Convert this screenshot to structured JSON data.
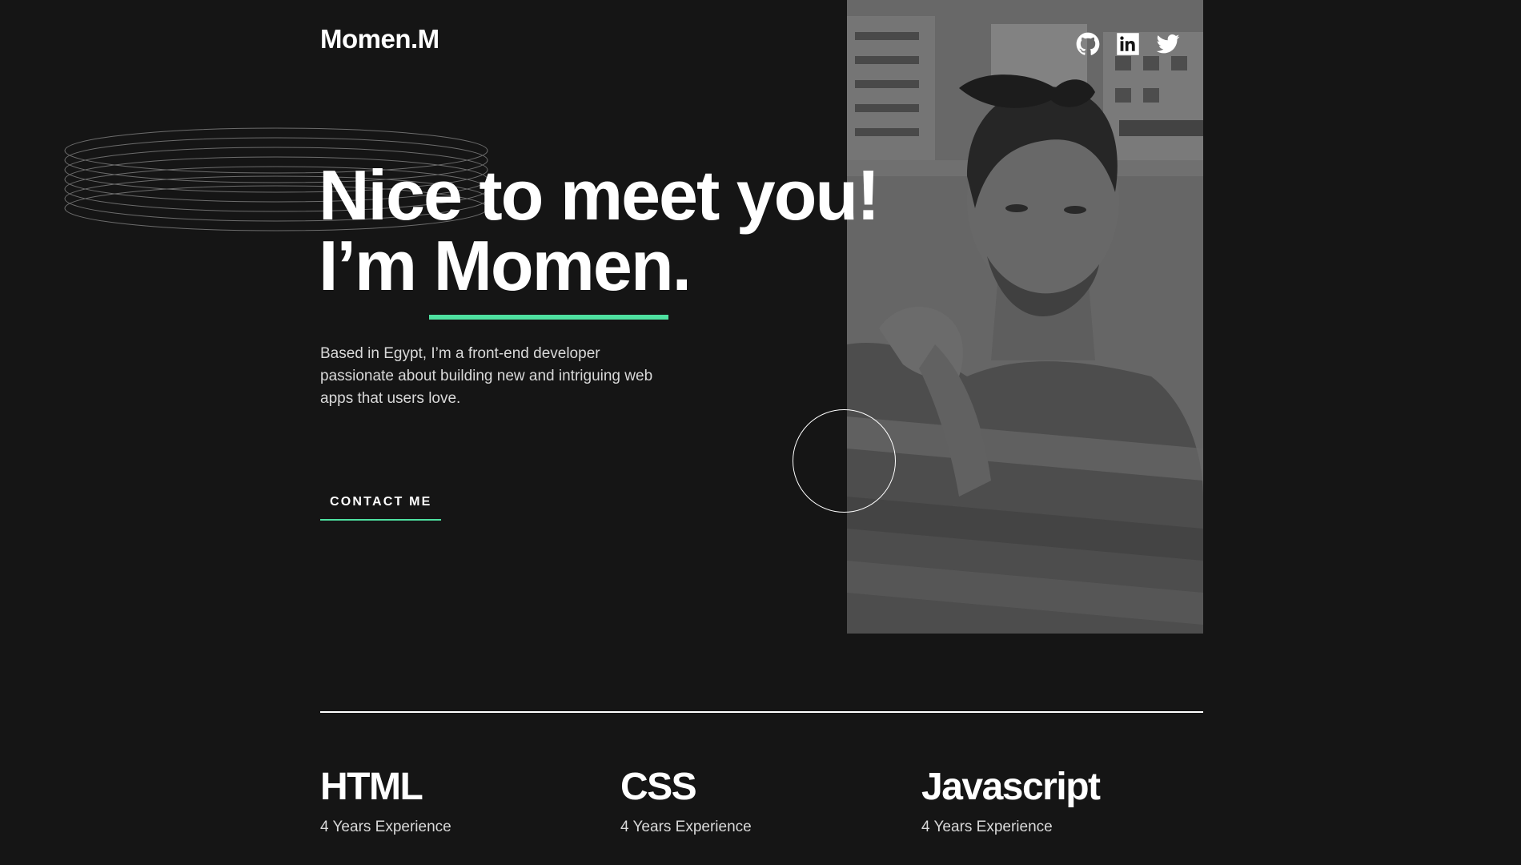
{
  "header": {
    "logo": "Momen.M",
    "socials": [
      {
        "name": "GitHub",
        "icon": "github-icon"
      },
      {
        "name": "LinkedIn",
        "icon": "linkedin-icon"
      },
      {
        "name": "Twitter",
        "icon": "twitter-icon"
      }
    ]
  },
  "hero": {
    "title_line1": "Nice to meet you!",
    "title_line2_prefix": "I’m ",
    "title_name": "Momen.",
    "intro": "Based in Egypt, I’m a front-end developer passionate about building new and intriguing web apps that users love.",
    "contact_label": "CONTACT ME",
    "photo": "profile-photo"
  },
  "skills": [
    {
      "name": "HTML",
      "experience": "4 Years Experience"
    },
    {
      "name": "CSS",
      "experience": "4 Years Experience"
    },
    {
      "name": "Javascript",
      "experience": "4 Years Experience"
    }
  ],
  "colors": {
    "background": "#151515",
    "accent": "#4ee1a0",
    "text": "#ffffff",
    "muted_text": "#d9d9d9"
  }
}
